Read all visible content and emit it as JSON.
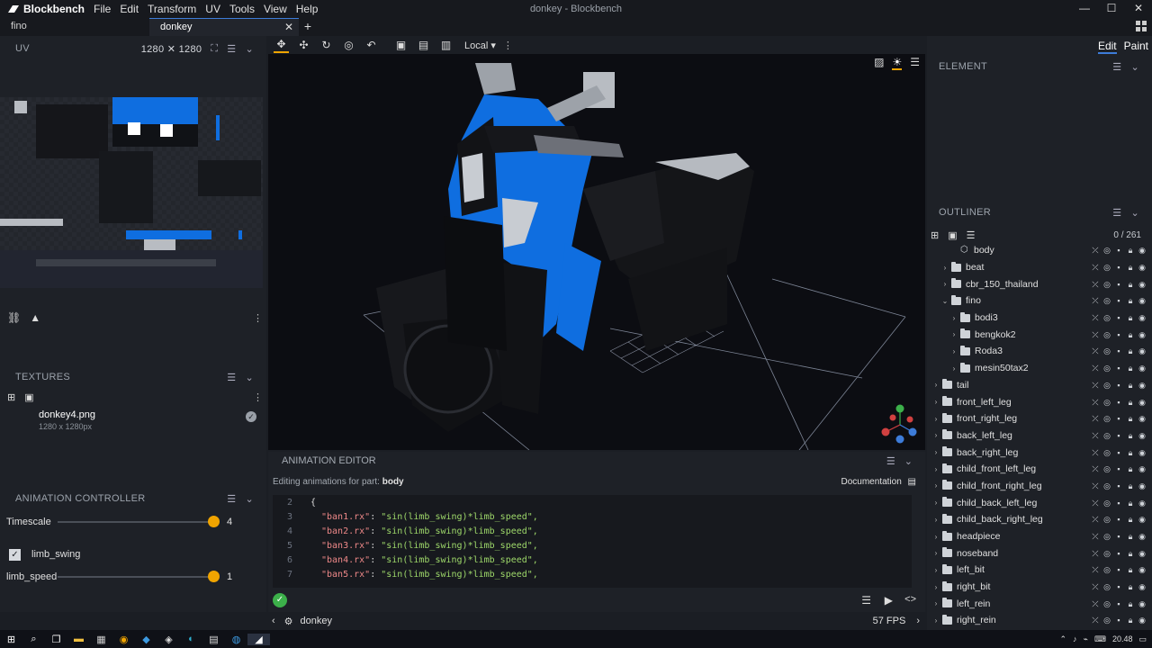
{
  "app": {
    "name": "Blockbench",
    "window_title": "donkey - Blockbench"
  },
  "menu": [
    "File",
    "Edit",
    "Transform",
    "UV",
    "Tools",
    "View",
    "Help"
  ],
  "tabs": [
    {
      "label": "fino"
    },
    {
      "label": "donkey"
    }
  ],
  "uv_panel": {
    "title": "UV",
    "resolution": "1280 ✕ 1280"
  },
  "textures": {
    "title": "TEXTURES",
    "items": [
      {
        "name": "donkey4.png",
        "size": "1280 x 1280px"
      }
    ]
  },
  "animation_controller": {
    "title": "ANIMATION CONTROLLER",
    "timescale": {
      "label": "Timescale",
      "value": "4",
      "fraction": 1.0
    },
    "limb_swing": {
      "label": "limb_swing",
      "checked": true
    },
    "limb_speed": {
      "label": "limb_speed",
      "value": "1",
      "fraction": 1.0
    }
  },
  "toolbar": {
    "space": "Local"
  },
  "animation_editor": {
    "title": "ANIMATION EDITOR",
    "subtitle_prefix": "Editing animations for part:",
    "part": "body",
    "documentation": "Documentation",
    "lines": [
      {
        "n": "2",
        "key": "",
        "val": "{"
      },
      {
        "n": "3",
        "key": "\"ban1.rx\"",
        "val": "\"sin(limb_swing)*limb_speed\","
      },
      {
        "n": "4",
        "key": "\"ban2.rx\"",
        "val": "\"sin(limb_swing)*limb_speed\","
      },
      {
        "n": "5",
        "key": "\"ban3.rx\"",
        "val": "\"sin(limb_swing)*limb_speed\","
      },
      {
        "n": "6",
        "key": "\"ban4.rx\"",
        "val": "\"sin(limb_swing)*limb_speed\","
      },
      {
        "n": "7",
        "key": "\"ban5.rx\"",
        "val": "\"sin(limb_swing)*limb_speed\","
      }
    ]
  },
  "status": {
    "model": "donkey",
    "fps": "57 FPS"
  },
  "right_panel": {
    "mode_edit": "Edit",
    "mode_paint": "Paint",
    "element_title": "ELEMENT",
    "outliner_title": "OUTLINER",
    "count": "0 / 261",
    "tree": [
      {
        "label": "body",
        "depth": 2,
        "type": "cube"
      },
      {
        "label": "beat",
        "depth": 1,
        "type": "folder",
        "chev": "›"
      },
      {
        "label": "cbr_150_thailand",
        "depth": 1,
        "type": "folder",
        "chev": "›"
      },
      {
        "label": "fino",
        "depth": 1,
        "type": "folder",
        "chev": "⌄"
      },
      {
        "label": "bodi3",
        "depth": 2,
        "type": "folder",
        "chev": "›"
      },
      {
        "label": "bengkok2",
        "depth": 2,
        "type": "folder",
        "chev": "›"
      },
      {
        "label": "Roda3",
        "depth": 2,
        "type": "folder",
        "chev": "›"
      },
      {
        "label": "mesin50tax2",
        "depth": 2,
        "type": "folder",
        "chev": "›"
      },
      {
        "label": "tail",
        "depth": 0,
        "type": "folder",
        "chev": "›"
      },
      {
        "label": "front_left_leg",
        "depth": 0,
        "type": "folder",
        "chev": "›"
      },
      {
        "label": "front_right_leg",
        "depth": 0,
        "type": "folder",
        "chev": "›"
      },
      {
        "label": "back_left_leg",
        "depth": 0,
        "type": "folder",
        "chev": "›"
      },
      {
        "label": "back_right_leg",
        "depth": 0,
        "type": "folder",
        "chev": "›"
      },
      {
        "label": "child_front_left_leg",
        "depth": 0,
        "type": "folder",
        "chev": "›"
      },
      {
        "label": "child_front_right_leg",
        "depth": 0,
        "type": "folder",
        "chev": "›"
      },
      {
        "label": "child_back_left_leg",
        "depth": 0,
        "type": "folder",
        "chev": "›"
      },
      {
        "label": "child_back_right_leg",
        "depth": 0,
        "type": "folder",
        "chev": "›"
      },
      {
        "label": "headpiece",
        "depth": 0,
        "type": "folder",
        "chev": "›"
      },
      {
        "label": "noseband",
        "depth": 0,
        "type": "folder",
        "chev": "›"
      },
      {
        "label": "left_bit",
        "depth": 0,
        "type": "folder",
        "chev": "›"
      },
      {
        "label": "right_bit",
        "depth": 0,
        "type": "folder",
        "chev": "›"
      },
      {
        "label": "left_rein",
        "depth": 0,
        "type": "folder",
        "chev": "›"
      },
      {
        "label": "right_rein",
        "depth": 0,
        "type": "folder",
        "chev": "›"
      }
    ]
  },
  "taskbar": {
    "time": "20.48"
  },
  "colors": {
    "accent": "#f0a400",
    "selection": "#3d7cd9",
    "model_blue": "#0f6ee0"
  }
}
